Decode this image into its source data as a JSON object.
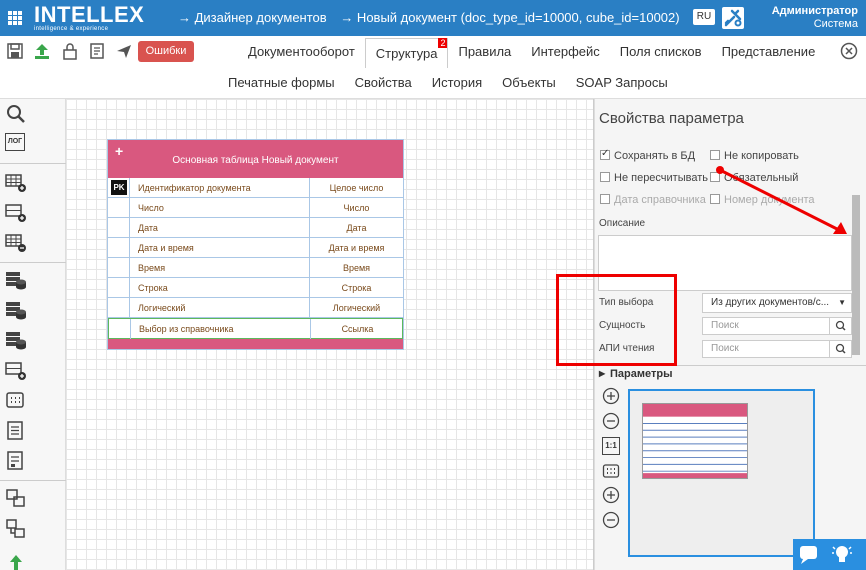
{
  "header": {
    "logo": "INTELLEX",
    "logo_sub": "intelligence & experience",
    "crumb1": "→  Дизайнер документов",
    "crumb2": "→  Новый документ (doc_type_id=10000, cube_id=10002)",
    "lang": "RU",
    "user_name": "Администратор",
    "user_role": "Система"
  },
  "toolbar": {
    "errors": "Ошибки"
  },
  "tabs1": [
    {
      "label": "Документооборот"
    },
    {
      "label": "Структура",
      "badge": "2"
    },
    {
      "label": "Правила"
    },
    {
      "label": "Интерфейс"
    },
    {
      "label": "Поля списков"
    },
    {
      "label": "Представление"
    }
  ],
  "tabs2": [
    {
      "label": "Печатные формы"
    },
    {
      "label": "Свойства"
    },
    {
      "label": "История"
    },
    {
      "label": "Объекты"
    },
    {
      "label": "SOAP Запросы"
    }
  ],
  "left_tools": {
    "log": "ЛОГ"
  },
  "table": {
    "plus": "+",
    "title": "Основная таблица Новый документ",
    "pk": "PK",
    "rows": [
      {
        "name": "Идентификатор документа",
        "type": "Целое число"
      },
      {
        "name": "Число",
        "type": "Число"
      },
      {
        "name": "Дата",
        "type": "Дата"
      },
      {
        "name": "Дата и время",
        "type": "Дата и время"
      },
      {
        "name": "Время",
        "type": "Время"
      },
      {
        "name": "Строка",
        "type": "Строка"
      },
      {
        "name": "Логический",
        "type": "Логический"
      },
      {
        "name": "Выбор из справочника",
        "type": "Ссылка"
      }
    ]
  },
  "props": {
    "title": "Свойства параметра",
    "save_db": "Сохранять в БД",
    "no_copy": "Не копировать",
    "no_recalc": "Не пересчитывать",
    "required": "Обязательный",
    "ref_date": "Дата справочника",
    "doc_number": "Номер документа",
    "description": "Описание",
    "choice_type_label": "Тип выбора",
    "choice_type_value": "Из других документов/с...",
    "entity_label": "Сущность",
    "entity_placeholder": "Поиск",
    "api_label": "АПИ чтения",
    "api_placeholder": "Поиск"
  },
  "params": {
    "title": "Параметры"
  },
  "minimap": {
    "one_to_one": "1:1"
  }
}
